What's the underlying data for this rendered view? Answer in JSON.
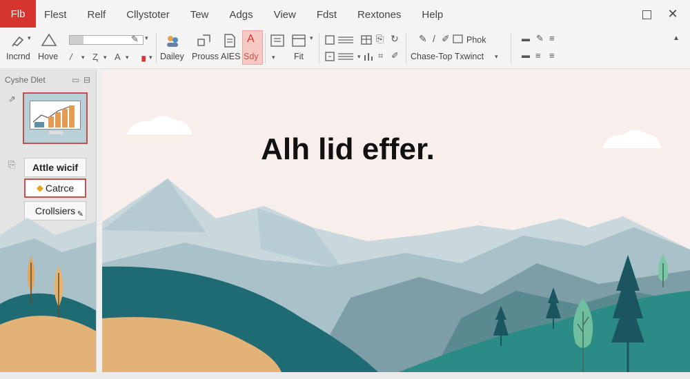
{
  "titlebar": {
    "file_tab": "Flb",
    "menu": [
      "Flest",
      "Relf",
      "Cllystoter",
      "Tew",
      "Adgs",
      "View",
      "Fdst",
      "Rextones",
      "Help"
    ]
  },
  "ribbon": {
    "labels": {
      "incrnd": "Incrnd",
      "hove": "Hove",
      "dailey": "Dailey",
      "prouss": "Prouss",
      "aies": "AIES",
      "sdy": "Sdy",
      "fit": "Fit",
      "phok": "Phok",
      "chase": "Chase-Top Txwinct"
    }
  },
  "panel": {
    "header": "Cyshe Dlet",
    "options": {
      "title": "Attle wicif",
      "capture": "Catrce",
      "collisiers": "Crollsiers"
    }
  },
  "slide": {
    "title": "Alh lid effer."
  },
  "colors": {
    "file_tab": "#d6342f",
    "accent_red": "#c2514b",
    "slide_bg": "#f8efed",
    "mountain_far": "#c8d8dc",
    "mountain_mid": "#a9c1c8",
    "hill_teal": "#1e6b73",
    "hill_green": "#2a8c84",
    "hill_sand": "#e3b277"
  }
}
